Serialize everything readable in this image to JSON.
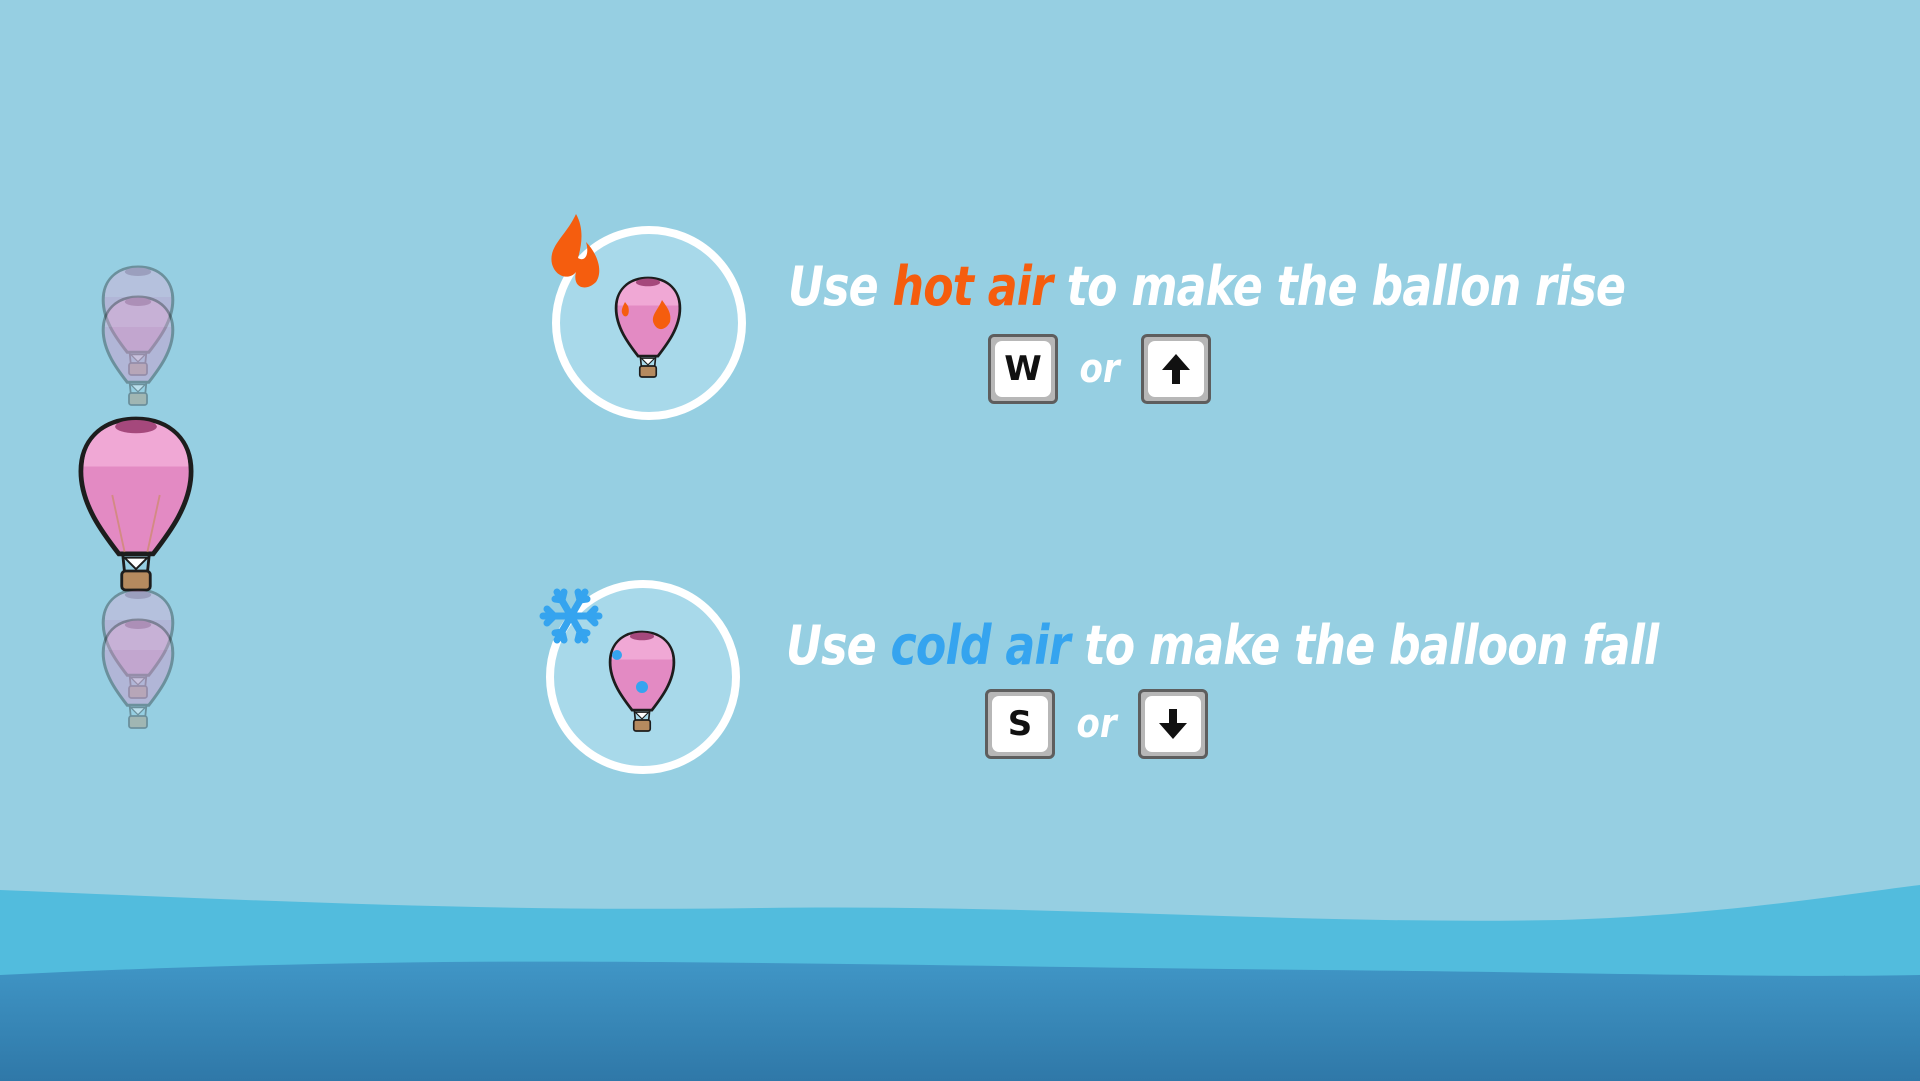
{
  "instructions": {
    "rise": {
      "prefix": "Use",
      "highlight": "hot air",
      "suffix": "to make the ballon rise",
      "key_primary": "W",
      "or_text": "or",
      "key_secondary_icon": "arrow-up-icon"
    },
    "fall": {
      "prefix": "Use",
      "highlight": "cold air",
      "suffix": "to make the balloon fall",
      "key_primary": "S",
      "or_text": "or",
      "key_secondary_icon": "arrow-down-icon"
    }
  },
  "colors": {
    "sky": "#96cfe2",
    "hot": "#f55d0e",
    "cold": "#35a4ef",
    "balloon_pink": "#e88fc4",
    "water_light": "#54bcdc",
    "water_dark": "#3d8fbf"
  }
}
